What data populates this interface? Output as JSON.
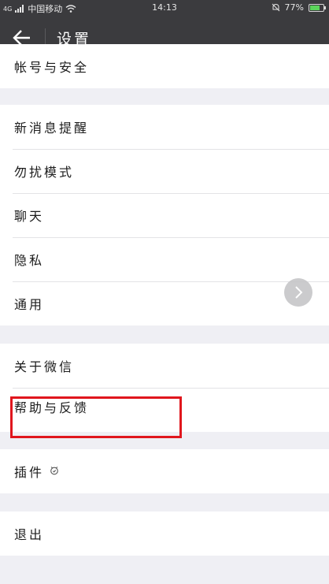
{
  "status": {
    "network": "4G",
    "carrier": "中国移动",
    "time": "14:13",
    "battery_percent": "77%",
    "battery_level": 0.77
  },
  "header": {
    "back_icon": "arrow-left-icon",
    "title": "设置"
  },
  "groups": [
    {
      "items": [
        {
          "label": "帐号与安全"
        }
      ]
    },
    {
      "items": [
        {
          "label": "新消息提醒"
        },
        {
          "label": "勿扰模式"
        },
        {
          "label": "聊天"
        },
        {
          "label": "隐私"
        },
        {
          "label": "通用"
        }
      ]
    },
    {
      "items": [
        {
          "label": "关于微信"
        },
        {
          "label": "帮助与反馈"
        }
      ]
    },
    {
      "items": [
        {
          "label": "插件",
          "icon": "plugin-icon"
        }
      ]
    },
    {
      "items": [
        {
          "label": "退出"
        }
      ]
    }
  ],
  "highlight_color": "#e0161d"
}
